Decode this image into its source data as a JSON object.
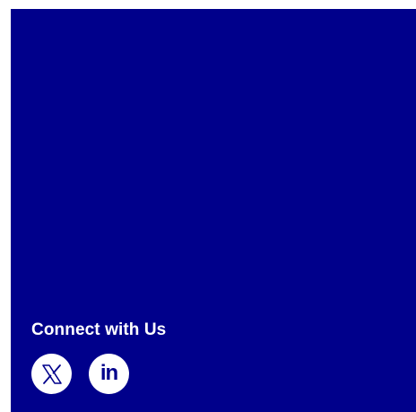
{
  "footer": {
    "connect_title": "Connect with Us",
    "social": [
      {
        "name": "X",
        "icon": "x-logo-icon"
      },
      {
        "name": "LinkedIn",
        "icon": "linkedin-icon",
        "glyph": "in"
      }
    ]
  },
  "colors": {
    "panel_background": "#00008b",
    "icon_circle": "#ffffff",
    "text": "#ffffff"
  }
}
